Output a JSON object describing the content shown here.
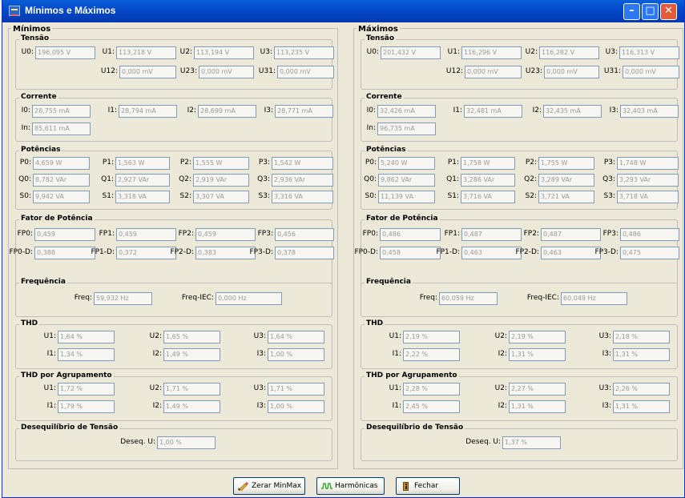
{
  "window": {
    "title": "Mínimos e Máximos",
    "title_icon": "meter-app-icon",
    "controls": [
      "minimize",
      "maximize",
      "close"
    ]
  },
  "panels": [
    {
      "title": "Mínimos",
      "tensao": {
        "title": "Tensão",
        "fields": [
          {
            "label": "U0:",
            "value": "196,095 V"
          },
          {
            "label": "U1:",
            "value": "113,218 V"
          },
          {
            "label": "U2:",
            "value": "113,194 V"
          },
          {
            "label": "U3:",
            "value": "113,235 V"
          },
          {
            "label": "U12:",
            "value": "0,000 mV"
          },
          {
            "label": "U23:",
            "value": "0,000 mV"
          },
          {
            "label": "U31:",
            "value": "0,000 mV"
          }
        ]
      },
      "corrente": {
        "title": "Corrente",
        "fields": [
          {
            "label": "I0:",
            "value": "28,755 mA"
          },
          {
            "label": "I1:",
            "value": "28,794 mA"
          },
          {
            "label": "I2:",
            "value": "28,699 mA"
          },
          {
            "label": "I3:",
            "value": "28,771 mA"
          },
          {
            "label": "In:",
            "value": "85,611 mA"
          }
        ]
      },
      "potencias": {
        "title": "Potências",
        "fields": [
          {
            "label": "P0:",
            "value": "4,659 W"
          },
          {
            "label": "P1:",
            "value": "1,563 W"
          },
          {
            "label": "P2:",
            "value": "1,555 W"
          },
          {
            "label": "P3:",
            "value": "1,542 W"
          },
          {
            "label": "Q0:",
            "value": "8,782 VAr"
          },
          {
            "label": "Q1:",
            "value": "2,927 VAr"
          },
          {
            "label": "Q2:",
            "value": "2,919 VAr"
          },
          {
            "label": "Q3:",
            "value": "2,936 VAr"
          },
          {
            "label": "S0:",
            "value": "9,942 VA"
          },
          {
            "label": "S1:",
            "value": "3,318 VA"
          },
          {
            "label": "S2:",
            "value": "3,307 VA"
          },
          {
            "label": "S3:",
            "value": "3,316 VA"
          }
        ]
      },
      "fator": {
        "title": "Fator de Potência",
        "fields": [
          {
            "label": "FP0:",
            "value": "0,459"
          },
          {
            "label": "FP1:",
            "value": "0,459"
          },
          {
            "label": "FP2:",
            "value": "0,459"
          },
          {
            "label": "FP3:",
            "value": "0,456"
          },
          {
            "label": "FP0-D:",
            "value": "0,388"
          },
          {
            "label": "FP1-D:",
            "value": "0,372"
          },
          {
            "label": "FP2-D:",
            "value": "0,383"
          },
          {
            "label": "FP3-D:",
            "value": "0,378"
          }
        ]
      },
      "frequencia": {
        "title": "Frequência",
        "fields": [
          {
            "label": "Freq:",
            "value": "59,932 Hz"
          },
          {
            "label": "Freq-IEC:",
            "value": "0,000 Hz"
          }
        ]
      },
      "thd": {
        "title": "THD",
        "fields": [
          {
            "label": "U1:",
            "value": "1,64 %"
          },
          {
            "label": "U2:",
            "value": "1,65 %"
          },
          {
            "label": "U3:",
            "value": "1,64 %"
          },
          {
            "label": "I1:",
            "value": "1,34 %"
          },
          {
            "label": "I2:",
            "value": "1,49 %"
          },
          {
            "label": "I3:",
            "value": "1,00 %"
          }
        ]
      },
      "thd_agrup": {
        "title": "THD por Agrupamento",
        "fields": [
          {
            "label": "U1:",
            "value": "1,72 %"
          },
          {
            "label": "U2:",
            "value": "1,71 %"
          },
          {
            "label": "U3:",
            "value": "1,71 %"
          },
          {
            "label": "I1:",
            "value": "1,79 %"
          },
          {
            "label": "I2:",
            "value": "1,49 %"
          },
          {
            "label": "I3:",
            "value": "1,00 %"
          }
        ]
      },
      "deseq": {
        "title": "Desequilíbrio de Tensão",
        "fields": [
          {
            "label": "Deseq. U:",
            "value": "1,00 %"
          }
        ]
      }
    },
    {
      "title": "Máximos",
      "tensao": {
        "title": "Tensão",
        "fields": [
          {
            "label": "U0:",
            "value": "201,432 V"
          },
          {
            "label": "U1:",
            "value": "116,296 V"
          },
          {
            "label": "U2:",
            "value": "116,282 V"
          },
          {
            "label": "U3:",
            "value": "116,313 V"
          },
          {
            "label": "U12:",
            "value": "0,000 mV"
          },
          {
            "label": "U23:",
            "value": "0,000 mV"
          },
          {
            "label": "U31:",
            "value": "0,000 mV"
          }
        ]
      },
      "corrente": {
        "title": "Corrente",
        "fields": [
          {
            "label": "I0:",
            "value": "32,426 mA"
          },
          {
            "label": "I1:",
            "value": "32,481 mA"
          },
          {
            "label": "I2:",
            "value": "32,435 mA"
          },
          {
            "label": "I3:",
            "value": "32,403 mA"
          },
          {
            "label": "In:",
            "value": "96,735 mA"
          }
        ]
      },
      "potencias": {
        "title": "Potências",
        "fields": [
          {
            "label": "P0:",
            "value": "5,240 W"
          },
          {
            "label": "P1:",
            "value": "1,758 W"
          },
          {
            "label": "P2:",
            "value": "1,755 W"
          },
          {
            "label": "P3:",
            "value": "1,748 W"
          },
          {
            "label": "Q0:",
            "value": "9,862 VAr"
          },
          {
            "label": "Q1:",
            "value": "3,286 VAr"
          },
          {
            "label": "Q2:",
            "value": "3,289 VAr"
          },
          {
            "label": "Q3:",
            "value": "3,293 VAr"
          },
          {
            "label": "S0:",
            "value": "11,139 VA"
          },
          {
            "label": "S1:",
            "value": "3,716 VA"
          },
          {
            "label": "S2:",
            "value": "3,721 VA"
          },
          {
            "label": "S3:",
            "value": "3,718 VA"
          }
        ]
      },
      "fator": {
        "title": "Fator de Potência",
        "fields": [
          {
            "label": "FP0:",
            "value": "0,486"
          },
          {
            "label": "FP1:",
            "value": "0,487"
          },
          {
            "label": "FP2:",
            "value": "0,487"
          },
          {
            "label": "FP3:",
            "value": "0,486"
          },
          {
            "label": "FP0-D:",
            "value": "0,458"
          },
          {
            "label": "FP1-D:",
            "value": "0,463"
          },
          {
            "label": "FP2-D:",
            "value": "0,463"
          },
          {
            "label": "FP3-D:",
            "value": "0,475"
          }
        ]
      },
      "frequencia": {
        "title": "Frequência",
        "fields": [
          {
            "label": "Freq:",
            "value": "60,059 Hz"
          },
          {
            "label": "Freq-IEC:",
            "value": "60,049 Hz"
          }
        ]
      },
      "thd": {
        "title": "THD",
        "fields": [
          {
            "label": "U1:",
            "value": "2,19 %"
          },
          {
            "label": "U2:",
            "value": "2,19 %"
          },
          {
            "label": "U3:",
            "value": "2,18 %"
          },
          {
            "label": "I1:",
            "value": "2,22 %"
          },
          {
            "label": "I2:",
            "value": "1,31 %"
          },
          {
            "label": "I3:",
            "value": "1,31 %"
          }
        ]
      },
      "thd_agrup": {
        "title": "THD por Agrupamento",
        "fields": [
          {
            "label": "U1:",
            "value": "2,28 %"
          },
          {
            "label": "U2:",
            "value": "2,27 %"
          },
          {
            "label": "U3:",
            "value": "2,26 %"
          },
          {
            "label": "I1:",
            "value": "2,45 %"
          },
          {
            "label": "I2:",
            "value": "1,31 %"
          },
          {
            "label": "I3:",
            "value": "1,31 %"
          }
        ]
      },
      "deseq": {
        "title": "Desequilíbrio de Tensão",
        "fields": [
          {
            "label": "Deseq. U:",
            "value": "1,37 %"
          }
        ]
      }
    }
  ],
  "buttons": [
    {
      "label": "Zerar MinMax",
      "icon": "eraser-pencil-icon"
    },
    {
      "label": "Harmônicas",
      "icon": "harmonic-wave-icon"
    },
    {
      "label": "Fechar",
      "icon": "exit-door-icon"
    }
  ]
}
